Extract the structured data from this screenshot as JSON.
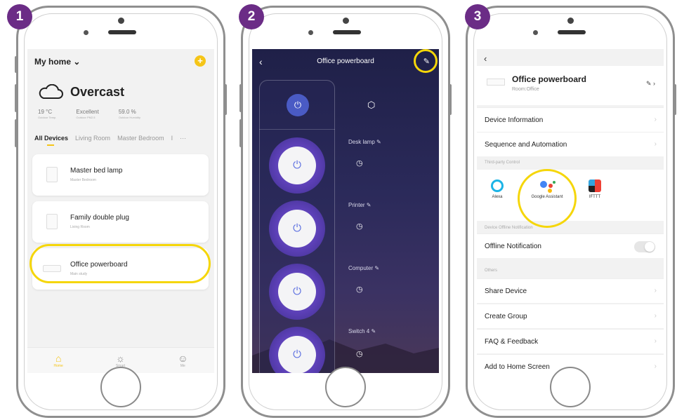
{
  "steps": [
    "1",
    "2",
    "3"
  ],
  "screen1": {
    "home_label": "My home",
    "home_chevron": "⌄",
    "add_glyph": "+",
    "weather": "Overcast",
    "stats": [
      {
        "value": "19 °C",
        "label": "Outdoor Temp."
      },
      {
        "value": "Excellent",
        "label": "Outdoor PM2.5"
      },
      {
        "value": "59.0 %",
        "label": "Outdoor Humidity"
      }
    ],
    "tabs": [
      "All Devices",
      "Living Room",
      "Master Bedroom",
      "I"
    ],
    "tabs_more": "···",
    "devices": [
      {
        "name": "Master bed lamp",
        "room": "Master Bedroom"
      },
      {
        "name": "Family double plug",
        "room": "Living Room"
      },
      {
        "name": "Office powerboard",
        "room": "Main study"
      }
    ],
    "nav": [
      {
        "label": "Home",
        "icon": "home-icon",
        "glyph": "⌂"
      },
      {
        "label": "Smart",
        "icon": "sun-icon",
        "glyph": "☼"
      },
      {
        "label": "Me",
        "icon": "profile-icon",
        "glyph": "☺"
      }
    ],
    "accent": "#f5c518"
  },
  "screen2": {
    "back_glyph": "‹",
    "title": "Office powerboard",
    "edit_glyph": "✎",
    "master_glyph": "⏻",
    "cube_glyph": "⬡",
    "clock_glyph": "◷",
    "sockets": [
      {
        "label": "Desk lamp",
        "glyph": "⏻",
        "edit_glyph": "✎"
      },
      {
        "label": "Printer",
        "glyph": "⏻",
        "edit_glyph": "✎"
      },
      {
        "label": "Computer",
        "glyph": "⏻",
        "edit_glyph": "✎"
      },
      {
        "label": "Switch 4",
        "glyph": "⏻",
        "edit_glyph": "✎"
      }
    ]
  },
  "screen3": {
    "back_glyph": "‹",
    "device_name": "Office powerboard",
    "device_room": "Room:Office",
    "edit_glyph": "✎ ›",
    "chevron": "›",
    "rows_top": [
      "Device Information",
      "Sequence and Automation"
    ],
    "third_party_header": "Third-party Control",
    "third_party": [
      {
        "label": "Alexa",
        "icon": "alexa-icon"
      },
      {
        "label": "Google Assistant",
        "icon": "google-assistant-icon"
      },
      {
        "label": "IFTTT",
        "icon": "ifttt-icon"
      }
    ],
    "offline_header": "Device Offline Notification",
    "offline_label": "Offline Notification",
    "offline_on": false,
    "others_header": "Others",
    "rows_others": [
      "Share Device",
      "Create Group",
      "FAQ & Feedback",
      "Add to Home Screen"
    ]
  },
  "colors": {
    "badge": "#6b2c86",
    "highlight": "#f5d60a",
    "power_blue": "#5b6ee0"
  }
}
